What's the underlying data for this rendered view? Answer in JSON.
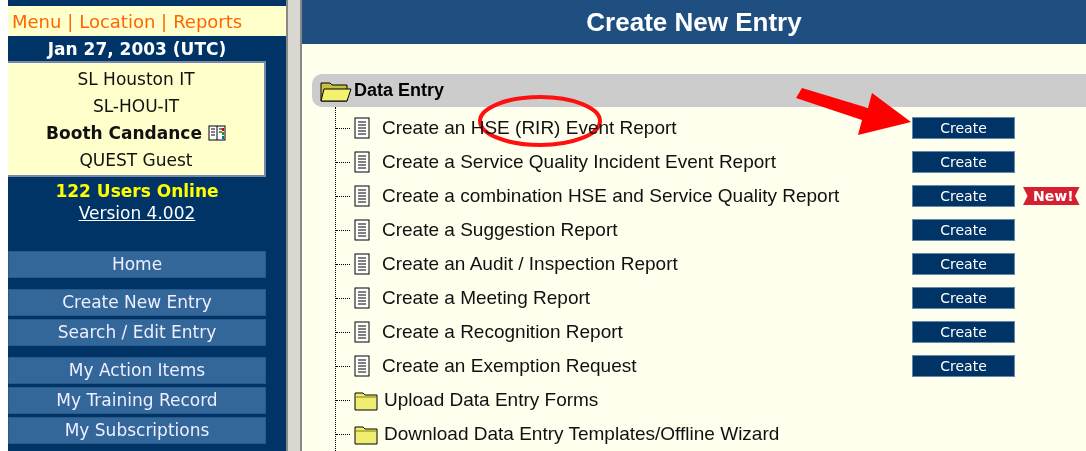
{
  "sidebar": {
    "top_links": [
      "Menu |",
      "Location |",
      "Reports"
    ],
    "date": "Jan 27, 2003 (UTC)",
    "user_box": [
      {
        "text": "SL Houston IT",
        "bold": false,
        "book_icon": false
      },
      {
        "text": "SL-HOU-IT",
        "bold": false,
        "book_icon": false
      },
      {
        "text": "Booth Candance",
        "bold": true,
        "book_icon": true
      },
      {
        "text": "QUEST Guest",
        "bold": false,
        "book_icon": false
      }
    ],
    "users_online": "122 Users Online",
    "version": "Version 4.002",
    "nav_groups": [
      [
        "Home"
      ],
      [
        "Create New Entry",
        "Search / Edit Entry"
      ],
      [
        "My Action Items",
        "My Training Record",
        "My Subscriptions"
      ]
    ]
  },
  "main": {
    "title": "Create New Entry",
    "section": {
      "title": "Data Entry",
      "expanded": true,
      "items": [
        {
          "kind": "report",
          "label": "Create an HSE (RIR) Event Report",
          "button": "Create"
        },
        {
          "kind": "report",
          "label": "Create a Service Quality Incident Event Report",
          "button": "Create"
        },
        {
          "kind": "report",
          "label": "Create a combination HSE and Service Quality Report",
          "button": "Create",
          "badge": "New!"
        },
        {
          "kind": "report",
          "label": "Create a Suggestion Report",
          "button": "Create"
        },
        {
          "kind": "report",
          "label": "Create an Audit / Inspection Report",
          "button": "Create"
        },
        {
          "kind": "report",
          "label": "Create a Meeting Report",
          "button": "Create"
        },
        {
          "kind": "report",
          "label": "Create a Recognition Report",
          "button": "Create"
        },
        {
          "kind": "report",
          "label": "Create an Exemption Request",
          "button": "Create"
        },
        {
          "kind": "folder",
          "label": "Upload Data Entry Forms"
        },
        {
          "kind": "folder",
          "label": "Download Data Entry Templates/Offline Wizard"
        }
      ]
    }
  }
}
